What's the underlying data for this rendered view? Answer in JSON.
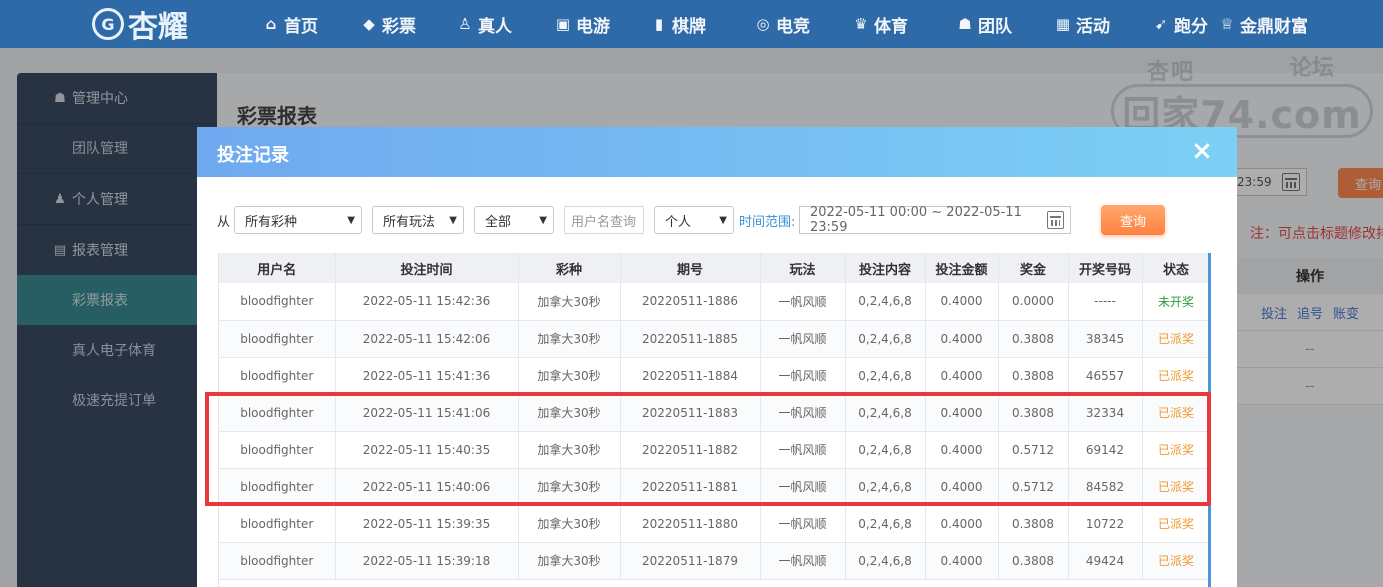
{
  "header": {
    "logo_text": "杏耀",
    "logo_badge": "G",
    "nav": [
      {
        "label": "首页",
        "icon": "home-icon",
        "glyph": "⌂"
      },
      {
        "label": "彩票",
        "icon": "lottery-ticket-icon",
        "glyph": "◆"
      },
      {
        "label": "真人",
        "icon": "live-dealer-icon",
        "glyph": "♙"
      },
      {
        "label": "电游",
        "icon": "slot-machine-icon",
        "glyph": "▣"
      },
      {
        "label": "棋牌",
        "icon": "cards-icon",
        "glyph": "▮"
      },
      {
        "label": "电竞",
        "icon": "gamepad-icon",
        "glyph": "◎"
      },
      {
        "label": "体育",
        "icon": "trophy-icon",
        "glyph": "♛"
      },
      {
        "label": "团队",
        "icon": "team-icon",
        "glyph": "☗"
      },
      {
        "label": "活动",
        "icon": "gift-icon",
        "glyph": "▦"
      },
      {
        "label": "跑分",
        "icon": "running-icon",
        "glyph": "➹"
      },
      {
        "label": "金鼎财富",
        "icon": "wealth-icon",
        "glyph": "♕"
      }
    ]
  },
  "watermark": {
    "top_left": "杏吧",
    "top_right": "论坛",
    "main": "回家74.com"
  },
  "sidebar": {
    "groups": [
      {
        "label": "管理中心",
        "icon": "users-icon",
        "glyph": "☗"
      },
      {
        "label": "个人管理",
        "icon": "user-icon",
        "glyph": "♟"
      },
      {
        "label": "报表管理",
        "icon": "report-icon",
        "glyph": "▤"
      }
    ],
    "items": {
      "team": "团队管理",
      "lottery_report": "彩票报表",
      "live_sports": "真人电子体育",
      "fast_deposit": "极速充提订单"
    }
  },
  "background": {
    "page_title": "彩票报表",
    "date_tail": "23:59",
    "query": "查询",
    "note": "注：可点击标题修改排",
    "col_ops": "操作",
    "ops": [
      "投注",
      "追号",
      "账变"
    ],
    "empty": "--"
  },
  "modal": {
    "title": "投注记录",
    "close": "×",
    "from_label": "从",
    "lottery_select": "所有彩种",
    "play_select": "所有玩法",
    "scope_select": "全部",
    "username_placeholder": "用户名查询",
    "person_select": "个人",
    "range_label": "时间范围:",
    "date_range": "2022-05-11 00:00 ~ 2022-05-11 23:59",
    "query_button": "查询",
    "columns": [
      "用户名",
      "投注时间",
      "彩种",
      "期号",
      "玩法",
      "投注内容",
      "投注金额",
      "奖金",
      "开奖号码",
      "状态"
    ],
    "rows": [
      [
        "bloodfighter",
        "2022-05-11 15:42:36",
        "加拿大30秒",
        "20220511-1886",
        "一帆风顺",
        "0,2,4,6,8",
        "0.4000",
        "0.0000",
        "-----",
        "未开奖"
      ],
      [
        "bloodfighter",
        "2022-05-11 15:42:06",
        "加拿大30秒",
        "20220511-1885",
        "一帆风顺",
        "0,2,4,6,8",
        "0.4000",
        "0.3808",
        "38345",
        "已派奖"
      ],
      [
        "bloodfighter",
        "2022-05-11 15:41:36",
        "加拿大30秒",
        "20220511-1884",
        "一帆风顺",
        "0,2,4,6,8",
        "0.4000",
        "0.3808",
        "46557",
        "已派奖"
      ],
      [
        "bloodfighter",
        "2022-05-11 15:41:06",
        "加拿大30秒",
        "20220511-1883",
        "一帆风顺",
        "0,2,4,6,8",
        "0.4000",
        "0.3808",
        "32334",
        "已派奖"
      ],
      [
        "bloodfighter",
        "2022-05-11 15:40:35",
        "加拿大30秒",
        "20220511-1882",
        "一帆风顺",
        "0,2,4,6,8",
        "0.4000",
        "0.5712",
        "69142",
        "已派奖"
      ],
      [
        "bloodfighter",
        "2022-05-11 15:40:06",
        "加拿大30秒",
        "20220511-1881",
        "一帆风顺",
        "0,2,4,6,8",
        "0.4000",
        "0.5712",
        "84582",
        "已派奖"
      ],
      [
        "bloodfighter",
        "2022-05-11 15:39:35",
        "加拿大30秒",
        "20220511-1880",
        "一帆风顺",
        "0,2,4,6,8",
        "0.4000",
        "0.3808",
        "10722",
        "已派奖"
      ],
      [
        "bloodfighter",
        "2022-05-11 15:39:18",
        "加拿大30秒",
        "20220511-1879",
        "一帆风顺",
        "0,2,4,6,8",
        "0.4000",
        "0.3808",
        "49424",
        "已派奖"
      ]
    ],
    "status_colors": {
      "未开奖": "#2e9b3c",
      "已派奖": "#f09a2c"
    }
  }
}
